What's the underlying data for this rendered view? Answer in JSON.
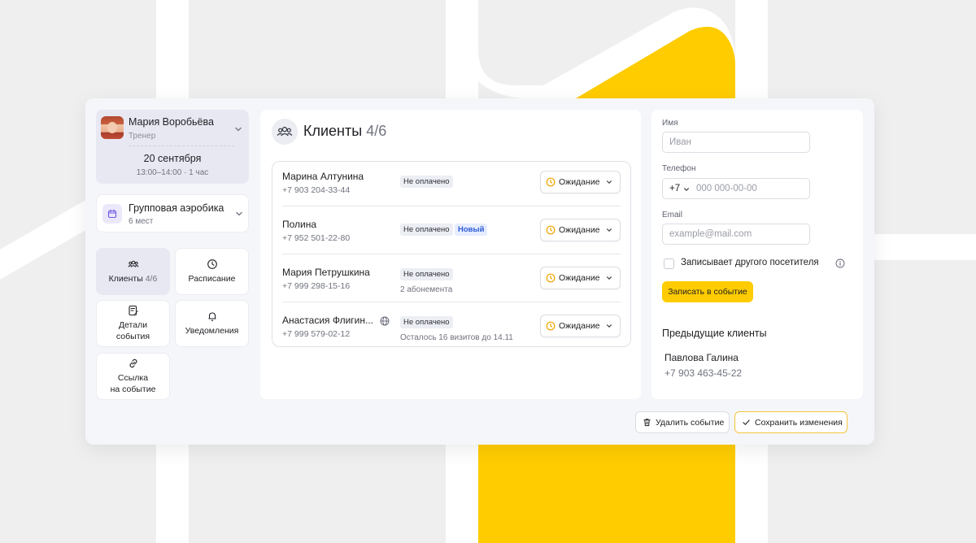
{
  "trainer": {
    "name": "Мария Воробьёва",
    "role": "Тренер",
    "date": "20 сентября",
    "time": "13:00–14:00 · 1 час"
  },
  "event": {
    "name": "Групповая аэробика",
    "places": "6 мест"
  },
  "tiles": {
    "clients": "Клиенты",
    "clients_count": "4/6",
    "schedule": "Расписание",
    "details_1": "Детали",
    "details_2": "события",
    "notifications": "Уведомления",
    "link_1": "Ссылка",
    "link_2": "на событие"
  },
  "clients": {
    "title": "Клиенты",
    "count": "4/6",
    "rows": [
      {
        "name": "Марина Алтунина",
        "phone": "+7 903 204-33-44",
        "payment": "Не оплачено",
        "status": "Ожидание"
      },
      {
        "name": "Полина",
        "phone": "+7 952 501-22-80",
        "payment": "Не оплачено",
        "tag": "Новый",
        "status": "Ожидание"
      },
      {
        "name": "Мария Петрушкина",
        "phone": "+7 999 298-15-16",
        "payment": "Не оплачено",
        "note": "2 абонемента",
        "status": "Ожидание"
      },
      {
        "name": "Анастасия Флигин...",
        "phone": "+7 999 579-02-12",
        "payment": "Не оплачено",
        "note": "Осталось 16 визитов до 14.11",
        "status": "Ожидание"
      }
    ]
  },
  "form": {
    "name_label": "Имя",
    "name_placeholder": "Иван",
    "phone_label": "Телефон",
    "phone_code": "+7",
    "phone_placeholder": "000 000-00-00",
    "email_label": "Email",
    "email_placeholder": "example@mail.com",
    "other_visitor_label": "Записывает другого посетителя",
    "submit_label": "Записать в событие"
  },
  "previous": {
    "title": "Предыдущие клиенты",
    "name": "Павлова Галина",
    "phone": "+7 903 463-45-22"
  },
  "footer": {
    "delete_label": "Удалить событие",
    "save_label": "Сохранить изменения"
  },
  "colors": {
    "accent_yellow": "#ffcc00",
    "new_badge": "#2d5bd7",
    "pending_clock": "#f0a500"
  }
}
